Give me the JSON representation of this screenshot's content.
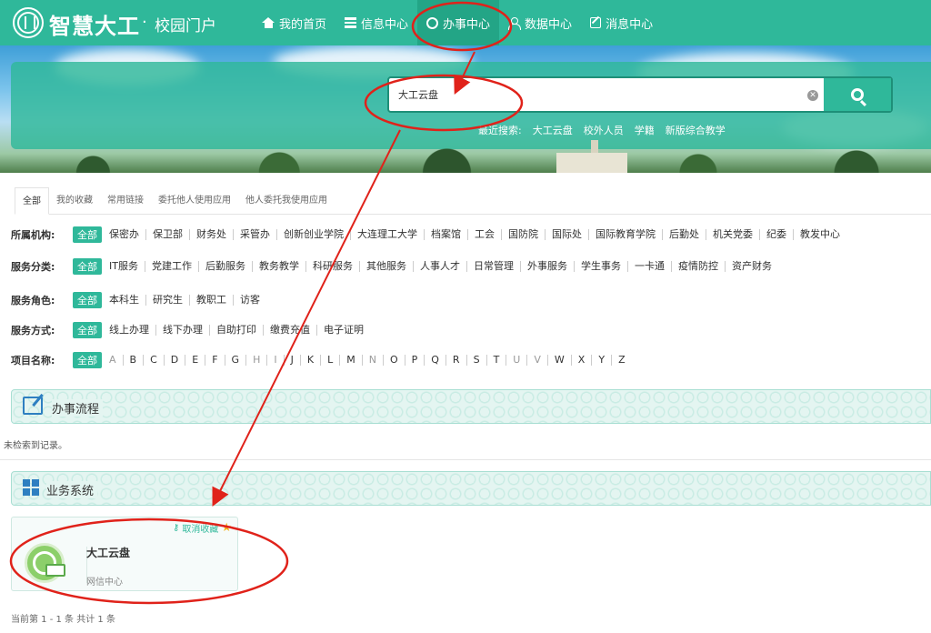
{
  "header": {
    "brand": "智慧大工",
    "separator": "·",
    "subtitle": "校园门户",
    "nav": [
      {
        "label": "我的首页",
        "icon": "home-icon"
      },
      {
        "label": "信息中心",
        "icon": "list-icon"
      },
      {
        "label": "办事中心",
        "icon": "service-icon",
        "active": true
      },
      {
        "label": "数据中心",
        "icon": "user-icon"
      },
      {
        "label": "消息中心",
        "icon": "edit-icon"
      }
    ]
  },
  "search": {
    "value": "大工云盘",
    "recent_label": "最近搜索:",
    "recent": [
      "大工云盘",
      "校外人员",
      "学籍",
      "新版综合教学"
    ]
  },
  "tabs": [
    "全部",
    "我的收藏",
    "常用链接",
    "委托他人使用应用",
    "他人委托我使用应用"
  ],
  "filters": {
    "all_label": "全部",
    "org": {
      "label": "所属机构:",
      "options": [
        "保密办",
        "保卫部",
        "财务处",
        "采管办",
        "创新创业学院",
        "大连理工大学",
        "档案馆",
        "工会",
        "国防院",
        "国际处",
        "国际教育学院",
        "后勤处",
        "机关党委",
        "纪委",
        "教发中心"
      ]
    },
    "category": {
      "label": "服务分类:",
      "options": [
        "IT服务",
        "党建工作",
        "后勤服务",
        "教务教学",
        "科研服务",
        "其他服务",
        "人事人才",
        "日常管理",
        "外事服务",
        "学生事务",
        "一卡通",
        "疫情防控",
        "资产财务"
      ]
    },
    "role": {
      "label": "服务角色:",
      "options": [
        "本科生",
        "研究生",
        "教职工",
        "访客"
      ]
    },
    "method": {
      "label": "服务方式:",
      "options": [
        "线上办理",
        "线下办理",
        "自助打印",
        "缴费充值",
        "电子证明"
      ]
    },
    "letters": {
      "label": "项目名称:",
      "options": [
        "A",
        "B",
        "C",
        "D",
        "E",
        "F",
        "G",
        "H",
        "I",
        "J",
        "K",
        "L",
        "M",
        "N",
        "O",
        "P",
        "Q",
        "R",
        "S",
        "T",
        "U",
        "V",
        "W",
        "X",
        "Y",
        "Z"
      ],
      "muted": [
        "A",
        "H",
        "I",
        "N",
        "U",
        "V"
      ]
    }
  },
  "sections": {
    "process": {
      "title": "办事流程",
      "empty": "未检索到记录。"
    },
    "systems": {
      "title": "业务系统"
    }
  },
  "card": {
    "fav_label": "取消收藏",
    "name": "大工云盘",
    "dept": "网信中心"
  },
  "pager": "当前第 1 - 1 条 共计 1 条",
  "colors": {
    "primary": "#2fb89a",
    "annotation": "#e0221a",
    "icon_blue": "#2e7fc1"
  }
}
